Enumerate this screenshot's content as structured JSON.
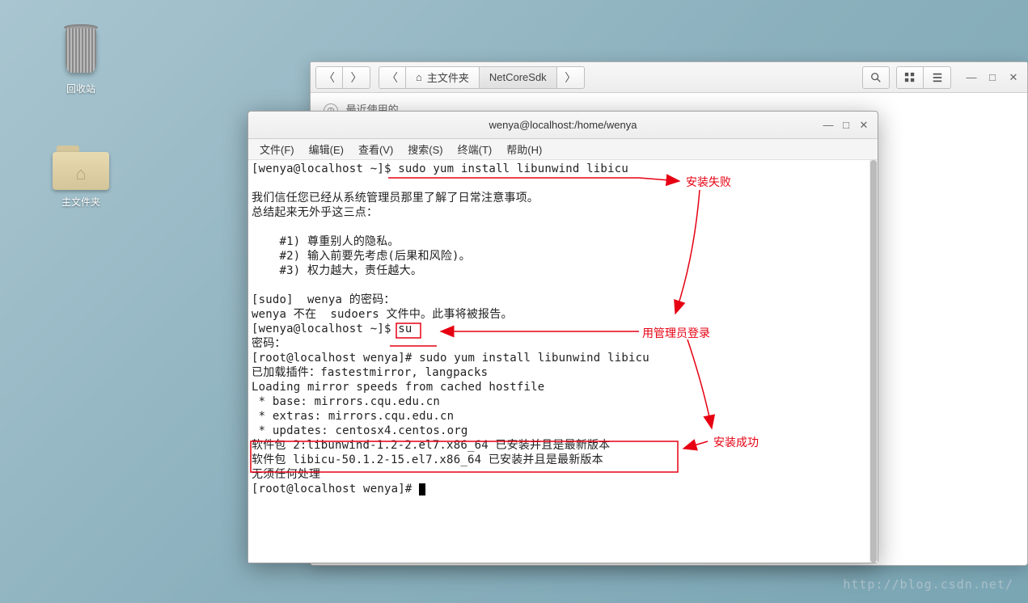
{
  "desktop": {
    "trash_label": "回收站",
    "home_label": "主文件夹"
  },
  "fm": {
    "path_home": "主文件夹",
    "path_current": "NetCoreSdk",
    "recent_label": "最近使用的"
  },
  "terminal": {
    "title": "wenya@localhost:/home/wenya",
    "menu": {
      "file": "文件(F)",
      "edit": "编辑(E)",
      "view": "查看(V)",
      "search": "搜索(S)",
      "terminal": "终端(T)",
      "help": "帮助(H)"
    },
    "lines": {
      "l1": "[wenya@localhost ~]$ sudo yum install libunwind libicu",
      "l2": "",
      "l3": "我们信任您已经从系统管理员那里了解了日常注意事项。",
      "l4": "总结起来无外乎这三点：",
      "l5": "",
      "l6": "    #1) 尊重别人的隐私。",
      "l7": "    #2) 输入前要先考虑(后果和风险)。",
      "l8": "    #3) 权力越大，责任越大。",
      "l9": "",
      "l10": "[sudo]  wenya 的密码：",
      "l11": "wenya 不在  sudoers 文件中。此事将被报告。",
      "l12": "[wenya@localhost ~]$ su",
      "l13": "密码：",
      "l14": "[root@localhost wenya]# sudo yum install libunwind libicu",
      "l15": "已加载插件：fastestmirror, langpacks",
      "l16": "Loading mirror speeds from cached hostfile",
      "l17": " * base: mirrors.cqu.edu.cn",
      "l18": " * extras: mirrors.cqu.edu.cn",
      "l19": " * updates: centosx4.centos.org",
      "l20": "软件包 2:libunwind-1.2-2.el7.x86_64 已安装并且是最新版本",
      "l21": "软件包 libicu-50.1.2-15.el7.x86_64 已安装并且是最新版本",
      "l22": "无须任何处理",
      "l23": "[root@localhost wenya]# "
    }
  },
  "annotations": {
    "fail": "安装失败",
    "admin": "用管理员登录",
    "success": "安装成功"
  },
  "watermark": "http://blog.csdn.net/"
}
